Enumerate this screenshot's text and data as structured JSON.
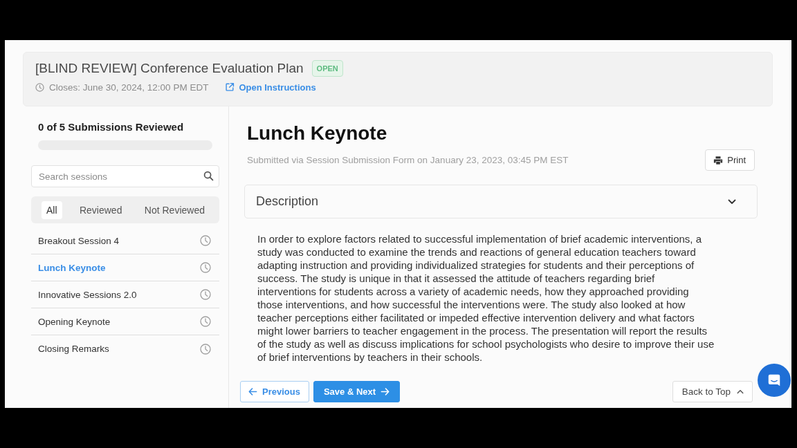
{
  "header": {
    "title": "[BLIND REVIEW] Conference Evaluation Plan",
    "status_badge": "OPEN",
    "closes": "Closes: June 30, 2024, 12:00 PM EDT",
    "instructions_link": "Open Instructions"
  },
  "sidebar": {
    "progress_label": "0 of 5 Submissions Reviewed",
    "progress": {
      "level": 0
    },
    "search": {
      "placeholder": "Search sessions"
    },
    "filter_tabs": [
      {
        "label": "All",
        "selected": true
      },
      {
        "label": "Reviewed",
        "selected": false
      },
      {
        "label": "Not Reviewed",
        "selected": false
      }
    ],
    "sessions": [
      {
        "name": "Breakout Session 4",
        "selected": false,
        "reviewed": false
      },
      {
        "name": "Lunch Keynote",
        "selected": true,
        "reviewed": false
      },
      {
        "name": "Innovative Sessions 2.0",
        "selected": false,
        "reviewed": false
      },
      {
        "name": "Opening Keynote",
        "selected": false,
        "reviewed": false
      },
      {
        "name": "Closing Remarks",
        "selected": false,
        "reviewed": false
      }
    ]
  },
  "submission": {
    "title": "Lunch Keynote",
    "submitted": "Submitted via Session Submission Form on January 23, 2023, 03:45 PM EST",
    "print_button": "Print",
    "section": {
      "title": "Description",
      "expanded": true,
      "text": "In order to explore factors related to successful implementation of brief academic interventions, a study was conducted to examine the trends and reactions of general education teachers toward adapting instruction and providing individualized strategies for students and their perceptions of success. The study is unique in that it assessed the attitude of teachers regarding brief interventions for students across a variety of academic needs, how they approached providing those interventions, and how successful the interventions were. The study also looked at how teacher perceptions either facilitated or impeded effective intervention delivery and what factors might lower barriers to teacher engagement in the process. The presentation will report the results of the study as well as discuss implications for school psychologists who desire to improve their use of brief interventions by teachers in their schools."
    }
  },
  "footer": {
    "previous_button": "Previous",
    "save_next_button": "Save & Next",
    "back_to_top_button": "Back to Top"
  }
}
